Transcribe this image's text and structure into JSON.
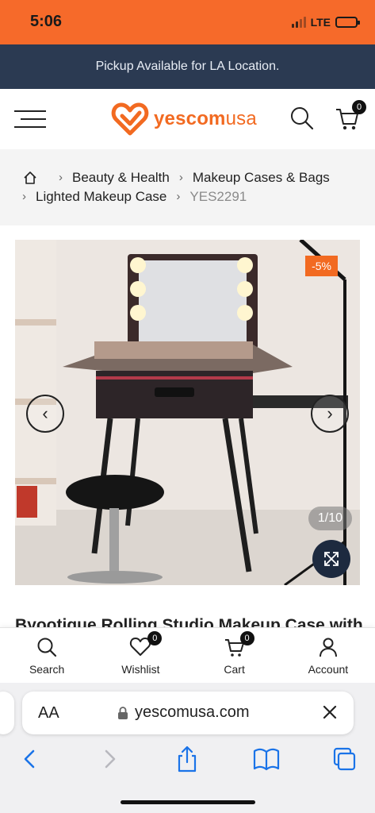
{
  "status_bar": {
    "time": "5:06",
    "network": "LTE"
  },
  "promo_banner": "Pickup Available for LA Location.",
  "header": {
    "logo_text_main": "yescom",
    "logo_text_suffix": "usa",
    "cart_count": "0"
  },
  "breadcrumb": {
    "items": [
      "Beauty & Health",
      "Makeup Cases & Bags",
      "Lighted Makeup Case"
    ],
    "current": "YES2291"
  },
  "gallery": {
    "discount_badge": "-5%",
    "counter": "1/10"
  },
  "product": {
    "title_peek": "Byootique Rolling Studio Makeup Case with"
  },
  "bottom_nav": {
    "items": [
      {
        "label": "Search",
        "icon": "search-icon"
      },
      {
        "label": "Wishlist",
        "icon": "heart-icon",
        "badge": "0"
      },
      {
        "label": "Cart",
        "icon": "cart-icon",
        "badge": "0"
      },
      {
        "label": "Account",
        "icon": "user-icon"
      }
    ]
  },
  "browser": {
    "text_size_label": "AA",
    "url": "yescomusa.com"
  },
  "colors": {
    "accent": "#f26a21",
    "promo_bg": "#2b3a52",
    "ios_blue": "#1a73e8"
  }
}
